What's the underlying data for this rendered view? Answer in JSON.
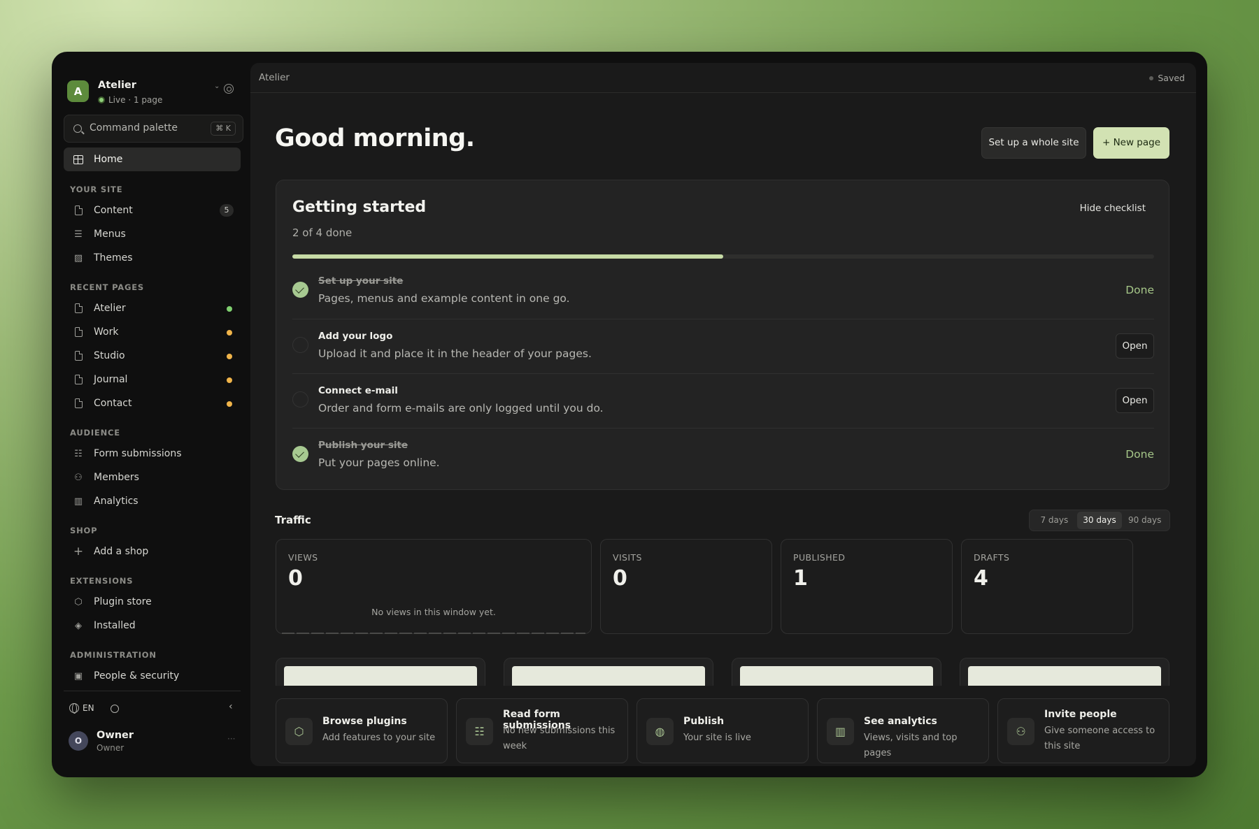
{
  "workspace": {
    "avatar": "A",
    "name": "Atelier",
    "status": "Live · 1 page"
  },
  "command_palette": {
    "label": "Command palette",
    "shortcut": "⌘ K"
  },
  "nav": {
    "home": "Home",
    "your_site": {
      "heading": "YOUR SITE",
      "items": [
        {
          "label": "Content",
          "badge": "5"
        },
        {
          "label": "Menus"
        },
        {
          "label": "Themes"
        }
      ]
    },
    "recent_pages": {
      "heading": "RECENT PAGES",
      "items": [
        {
          "label": "Atelier",
          "status_color": "#7fcf6f"
        },
        {
          "label": "Work",
          "status_color": "#f0b44a"
        },
        {
          "label": "Studio",
          "status_color": "#f0b44a"
        },
        {
          "label": "Journal",
          "status_color": "#f0b44a"
        },
        {
          "label": "Contact",
          "status_color": "#f0b44a"
        }
      ]
    },
    "audience": {
      "heading": "AUDIENCE",
      "items": [
        {
          "label": "Form submissions"
        },
        {
          "label": "Members"
        },
        {
          "label": "Analytics"
        }
      ]
    },
    "shop": {
      "heading": "SHOP",
      "items": [
        {
          "label": "Add a shop"
        }
      ]
    },
    "extensions": {
      "heading": "EXTENSIONS",
      "items": [
        {
          "label": "Plugin store"
        },
        {
          "label": "Installed"
        }
      ]
    },
    "administration": {
      "heading": "ADMINISTRATION",
      "items": [
        {
          "label": "People & security"
        }
      ]
    }
  },
  "footer": {
    "language": "EN",
    "user": {
      "avatar": "O",
      "name": "Owner",
      "role": "Owner"
    }
  },
  "topbar": {
    "breadcrumb": "Atelier",
    "save_status": "Saved"
  },
  "greeting": "Good morning.",
  "actions": {
    "setup": "Set up a whole site",
    "new_page": "+ New page"
  },
  "getting_started": {
    "title": "Getting started",
    "progress_text": "2 of 4 done",
    "progress": 0.5,
    "hide": "Hide checklist",
    "tasks": [
      {
        "title": "Set up your site",
        "desc": "Pages, menus and example content in one go.",
        "done": true,
        "action": "Done"
      },
      {
        "title": "Add your logo",
        "desc": "Upload it and place it in the header of your pages.",
        "done": false,
        "action": "Open"
      },
      {
        "title": "Connect e-mail",
        "desc": "Order and form e-mails are only logged until you do.",
        "done": false,
        "action": "Open"
      },
      {
        "title": "Publish your site",
        "desc": "Put your pages online.",
        "done": true,
        "action": "Done"
      }
    ]
  },
  "traffic": {
    "heading": "Traffic",
    "ranges": [
      "7 days",
      "30 days",
      "90 days"
    ],
    "selected_range": "30 days",
    "stats": [
      {
        "label": "VIEWS",
        "value": "0",
        "note": "No views in this window yet."
      },
      {
        "label": "VISITS",
        "value": "0"
      },
      {
        "label": "PUBLISHED",
        "value": "1"
      },
      {
        "label": "DRAFTS",
        "value": "4"
      }
    ]
  },
  "quick_actions": [
    {
      "title": "Browse plugins",
      "desc": "Add features to your site",
      "icon": "box-icon"
    },
    {
      "title": "Read form submissions",
      "desc": "No new submissions this week",
      "icon": "form-icon"
    },
    {
      "title": "Publish",
      "desc": "Your site is live",
      "icon": "globe-icon"
    },
    {
      "title": "See analytics",
      "desc": "Views, visits and top pages",
      "icon": "chart-icon"
    },
    {
      "title": "Invite people",
      "desc": "Give someone access to this site",
      "icon": "people-icon"
    }
  ],
  "colors": {
    "accent": "#d2e2b3",
    "done": "#a7c991",
    "live": "#8fd07a"
  }
}
